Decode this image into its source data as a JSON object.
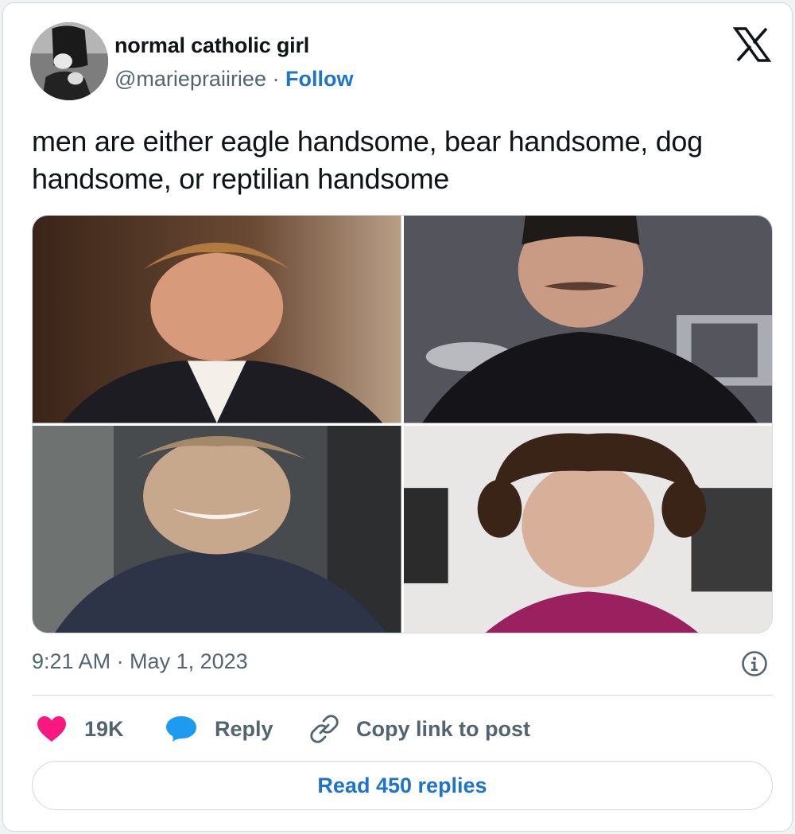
{
  "author": {
    "display_name": "normal catholic girl",
    "handle": "@mariepraiiriee",
    "separator": " · ",
    "follow_label": "Follow"
  },
  "tweet": {
    "text": "men are either eagle handsome, bear handsome, dog handsome, or reptilian handsome",
    "timestamp": "9:21 AM · May 1, 2023"
  },
  "actions": {
    "like_count": "19K",
    "reply_label": "Reply",
    "copy_link_label": "Copy link to post",
    "read_replies_label": "Read 450 replies"
  },
  "colors": {
    "link_blue": "#1d74c9",
    "like_pink": "#f91880",
    "reply_blue": "#1d9bf0",
    "muted_text": "#536471",
    "border": "#cfd9de"
  },
  "icons": {
    "platform": "x-logo-icon",
    "info": "info-icon",
    "like": "heart-icon",
    "reply": "speech-bubble-icon",
    "copy_link": "link-icon"
  }
}
